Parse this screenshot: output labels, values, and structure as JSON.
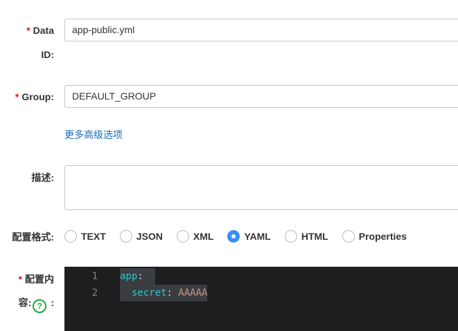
{
  "form": {
    "required_mark": "*",
    "data_id": {
      "label_line1": "Data",
      "label_line2": "ID:",
      "value": "app-public.yml"
    },
    "group": {
      "label": "Group:",
      "value": "DEFAULT_GROUP"
    },
    "advanced_link": "更多高级选项",
    "description": {
      "label": "描述:",
      "value": ""
    },
    "format": {
      "label": "配置格式:",
      "options": [
        "TEXT",
        "JSON",
        "XML",
        "YAML",
        "HTML",
        "Properties"
      ],
      "selected": "YAML"
    },
    "content": {
      "label_line1": "配置内",
      "label_line2": "容:",
      "help_symbol": "?",
      "colon": ":",
      "line_numbers": [
        "1",
        "2"
      ],
      "lines": [
        {
          "indent": "",
          "key": "app",
          "sep": ":",
          "value": ""
        },
        {
          "indent": "  ",
          "key": "secret",
          "sep": ": ",
          "value": "AAAAA"
        }
      ]
    }
  },
  "colors": {
    "required": "#e0151b",
    "link": "#1a6db5",
    "radio_selected": "#3a8ef5",
    "help": "#17a742",
    "editor_bg": "#1e1e1e"
  }
}
